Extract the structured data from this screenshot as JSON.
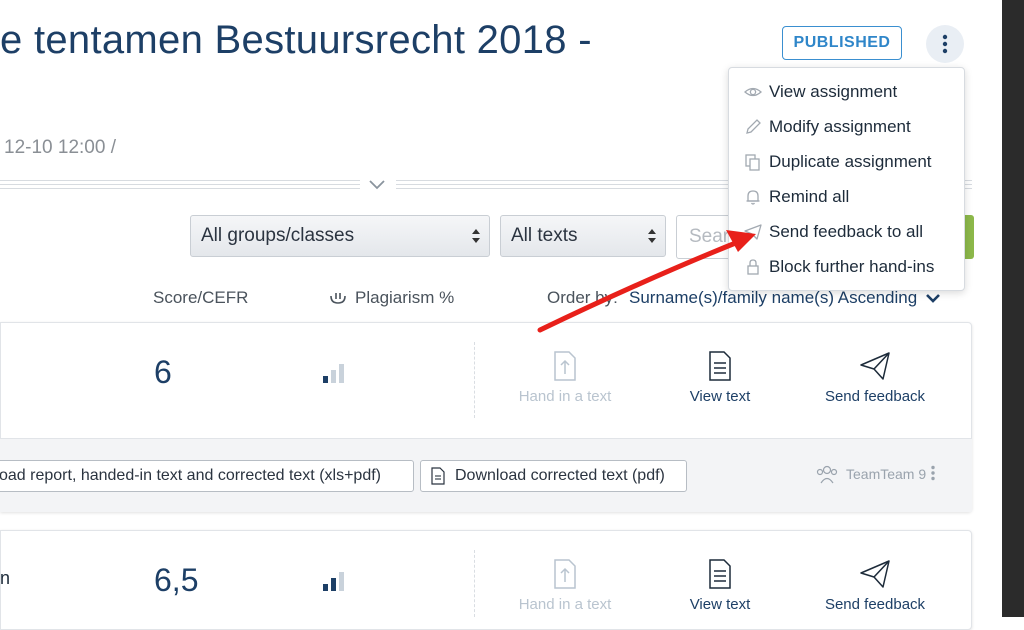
{
  "header": {
    "title": "e tentamen Bestuursrecht 2018 -",
    "subtitle": "12-10 12:00 /",
    "status_badge": "PUBLISHED"
  },
  "menu": {
    "items": [
      {
        "label": "View assignment",
        "icon": "eye-icon"
      },
      {
        "label": "Modify assignment",
        "icon": "pencil-icon"
      },
      {
        "label": "Duplicate assignment",
        "icon": "copy-icon"
      },
      {
        "label": "Remind all",
        "icon": "bell-icon"
      },
      {
        "label": "Send feedback to all",
        "icon": "paper-plane-icon"
      },
      {
        "label": "Block further hand-ins",
        "icon": "lock-icon"
      }
    ]
  },
  "filters": {
    "groups_value": "All groups/classes",
    "texts_value": "All texts",
    "search_placeholder": "Sear"
  },
  "columns": {
    "score": "Score/CEFR",
    "plagiarism": "Plagiarism %",
    "order_by_label": "Order by:",
    "order_by_value": "Surname(s)/family name(s) Ascending"
  },
  "rows": [
    {
      "name": "",
      "score": "6",
      "plagiarism_level": 0.33,
      "actions": {
        "hand_in": "Hand in a text",
        "view": "View text",
        "feedback": "Send feedback"
      },
      "downloads": [
        "oad report, handed-in text and corrected text (xls+pdf)",
        "Download corrected text (pdf)"
      ],
      "team": "TeamTeam 9"
    },
    {
      "name": "n",
      "score": "6,5",
      "plagiarism_level": 0.66,
      "actions": {
        "hand_in": "Hand in a text",
        "view": "View text",
        "feedback": "Send feedback"
      }
    }
  ],
  "colors": {
    "title": "#1d3f66",
    "badge": "#2f86c9",
    "annotation_arrow": "#e8201a",
    "accent_green": "#8cb84a"
  }
}
